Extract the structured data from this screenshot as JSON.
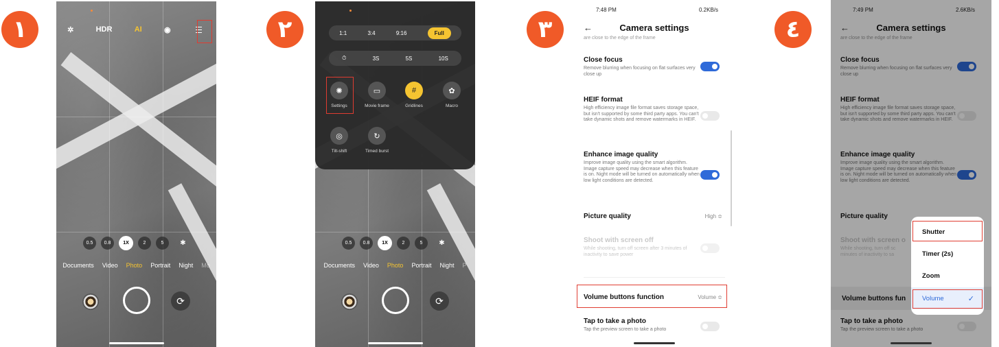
{
  "steps": [
    "١",
    "٢",
    "٣",
    "٤"
  ],
  "camera": {
    "top_bar": {
      "flash_icon": "flash-auto-icon",
      "hdr": "HDR",
      "ai": "AI",
      "lens_icon": "lens-icon",
      "menu_icon": "menu-icon"
    },
    "zoom": [
      "0.5",
      "0.8",
      "1X",
      "2",
      "5"
    ],
    "zoom_selected": "1X",
    "modes_p1": [
      "Documents",
      "Video",
      "Photo",
      "Portrait",
      "Night",
      "Mo"
    ],
    "modes_p2": [
      "Documents",
      "Video",
      "Photo",
      "Portrait",
      "Night",
      "P"
    ],
    "active_mode": "Photo"
  },
  "quick_panel": {
    "ratios": [
      "1:1",
      "3:4",
      "9:16",
      "Full"
    ],
    "ratio_selected": "Full",
    "timers": [
      "⏱",
      "3S",
      "5S",
      "10S"
    ],
    "tools": [
      {
        "label": "Settings",
        "icon": "gear-icon",
        "glyph": "✺"
      },
      {
        "label": "Movie frame",
        "icon": "movie-frame-icon",
        "glyph": "▭"
      },
      {
        "label": "Gridlines",
        "icon": "grid-icon",
        "glyph": "#"
      },
      {
        "label": "Macro",
        "icon": "macro-icon",
        "glyph": "✿"
      },
      {
        "label": "Tilt-shift",
        "icon": "tilt-shift-icon",
        "glyph": "◎"
      },
      {
        "label": "Timed burst",
        "icon": "timed-burst-icon",
        "glyph": "↻"
      }
    ]
  },
  "settings": {
    "title": "Camera settings",
    "status_p3": {
      "time": "7:48 PM",
      "net": "0.2KB/s"
    },
    "status_p4": {
      "time": "7:49 PM",
      "net": "2.6KB/s"
    },
    "clipped_text": "are close to the edge of the frame",
    "items": {
      "close_focus": {
        "title": "Close focus",
        "desc": "Remove blurring when focusing on flat surfaces very close up",
        "on": true
      },
      "heif": {
        "title": "HEIF format",
        "desc": "High efficiency image file format saves storage space, but isn't supported by some third party apps. You can't take dynamic shots and remove watermarks in HEIF.",
        "on": false
      },
      "enhance": {
        "title": "Enhance image quality",
        "desc": "Improve image quality using the smart algorithm. Image capture speed may decrease when this feature is on. Night mode will be turned on automatically when low light conditions are detected.",
        "on": true
      },
      "picture_quality": {
        "title": "Picture quality",
        "value": "High ≎"
      },
      "screen_off": {
        "title": "Shoot with screen off",
        "desc": "While shooting, turn off screen after 3 minutes of inactivity to save power",
        "on": false
      },
      "volume": {
        "title": "Volume buttons function",
        "value": "Volume ≎"
      },
      "tap_photo": {
        "title": "Tap to take a photo",
        "desc": "Tap the preview screen to take a photo",
        "on": false
      }
    },
    "p4_screen_off_title": "Shoot with screen o",
    "p4_screen_off_desc": "While shooting, turn off sc\nminutes of inactivity to sa",
    "p4_volume_title": "Volume buttons fun",
    "volume_options": [
      "Shutter",
      "Timer (2s)",
      "Zoom",
      "Volume"
    ],
    "volume_selected": "Volume"
  }
}
